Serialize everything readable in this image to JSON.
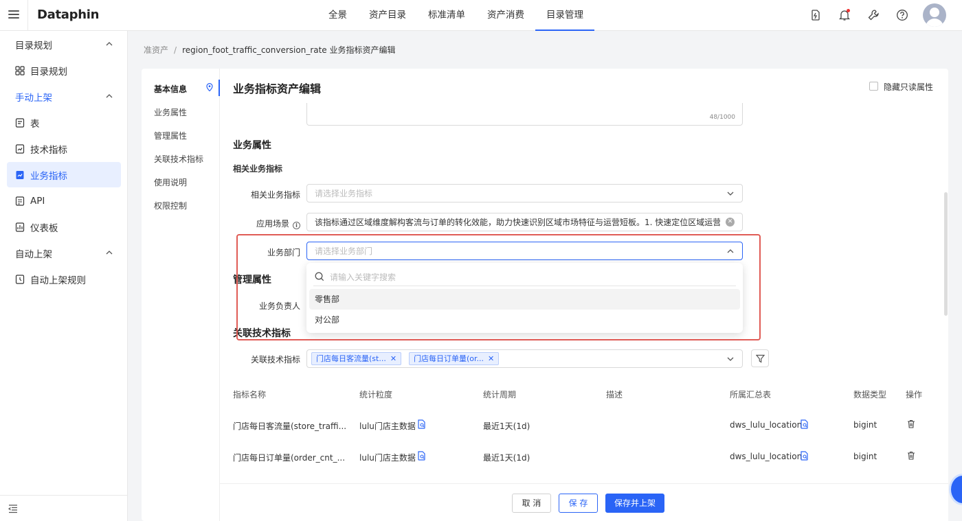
{
  "app": {
    "logo": "Dataphin"
  },
  "nav": {
    "tabs": [
      "全景",
      "资产目录",
      "标准清单",
      "资产消费",
      "目录管理"
    ]
  },
  "sidebar": {
    "group1": "目录规划",
    "item_plan": "目录规划",
    "group2": "手动上架",
    "item_table": "表",
    "item_tech": "技术指标",
    "item_biz": "业务指标",
    "item_api": "API",
    "item_dash": "仪表板",
    "group3": "自动上架",
    "item_auto": "自动上架规则"
  },
  "breadcrumb": {
    "parent": "准资产",
    "sep": "/",
    "current": "region_foot_traffic_conversion_rate 业务指标资产编辑"
  },
  "anchors": [
    "基本信息",
    "业务属性",
    "管理属性",
    "关联技术指标",
    "使用说明",
    "权限控制"
  ],
  "page": {
    "title": "业务指标资产编辑",
    "hide_readonly": "隐藏只读属性",
    "counter": "48/1000"
  },
  "biz": {
    "section": "业务属性",
    "sub": "相关业务指标",
    "related_label": "相关业务指标",
    "related_placeholder": "请选择业务指标",
    "scene_label": "应用场景",
    "scene_value": "该指标通过区域维度解构客流与订单的转化效能，助力快速识别区域市场特征与运营短板。1. 快速定位区域运营问题：",
    "dept_label": "业务部门",
    "dept_placeholder": "请选择业务部门"
  },
  "dropdown": {
    "search_placeholder": "请输入关键字搜索",
    "options": [
      "零售部",
      "对公部"
    ]
  },
  "mgmt": {
    "section": "管理属性",
    "owner_label": "业务负责人"
  },
  "tech": {
    "section": "关联技术指标",
    "label": "关联技术指标",
    "tags": [
      "门店每日客流量(st...",
      "门店每日订单量(or..."
    ],
    "columns": [
      "指标名称",
      "统计粒度",
      "统计周期",
      "描述",
      "所属汇总表",
      "数据类型",
      "操作"
    ],
    "rows": [
      {
        "name": "门店每日客流量(store_traffi...",
        "grain": "lulu门店主数据",
        "period": "最近1天(1d)",
        "desc": "",
        "table": "dws_lulu_location",
        "type": "bigint"
      },
      {
        "name": "门店每日订单量(order_cnt_...",
        "grain": "lulu门店主数据",
        "period": "最近1天(1d)",
        "desc": "",
        "table": "dws_lulu_location",
        "type": "bigint"
      }
    ]
  },
  "footer": {
    "cancel": "取 消",
    "save": "保 存",
    "save_publish": "保存并上架"
  },
  "colors": {
    "accent": "#2a64f6",
    "highlight_box": "#e05b55"
  }
}
